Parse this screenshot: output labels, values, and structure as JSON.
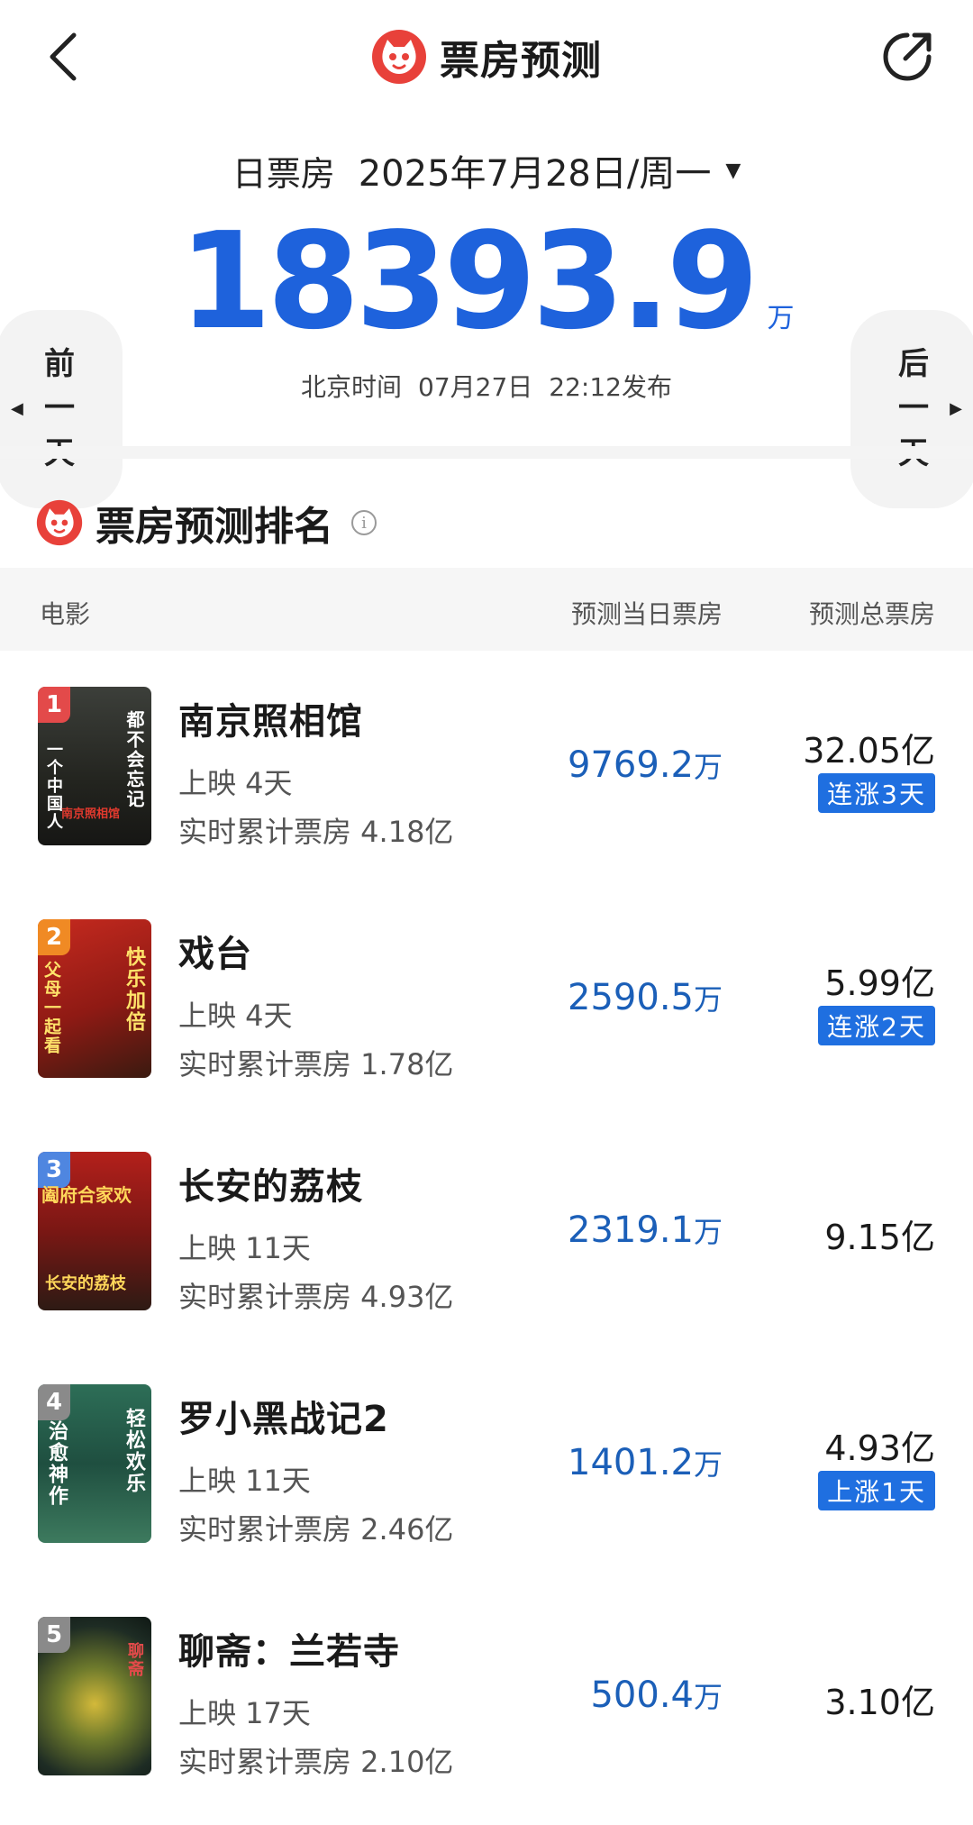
{
  "nav": {
    "title": "票房预测",
    "back_icon": "chevron-left-icon",
    "share_icon": "share-icon",
    "logo_color": "#e8413a"
  },
  "hero": {
    "date_label": "日票房",
    "date_value": "2025年7月28日/周一",
    "total_value": "18393.9",
    "total_unit": "万",
    "publish_zone": "北京时间",
    "publish_date": "07月27日",
    "publish_time": "22:12发布",
    "prev_label": [
      "前",
      "一",
      "天"
    ],
    "next_label": [
      "后",
      "一",
      "天"
    ],
    "accent_color": "#1e62dc"
  },
  "ranking": {
    "title": "票房预测排名",
    "columns": {
      "movie": "电影",
      "day": "预测当日票房",
      "total": "预测总票房"
    },
    "movies": [
      {
        "rank": "1",
        "title": "南京照相馆",
        "days": "上映 4天",
        "cumulative": "实时累计票房 4.18亿",
        "day_value": "9769.2",
        "day_unit": "万",
        "total": "32.05亿",
        "badge": "连涨3天",
        "rank_color": "#e34a4a",
        "poster_texts": [
          "都不会忘记",
          "一个中国人",
          "南京照相馆"
        ]
      },
      {
        "rank": "2",
        "title": "戏台",
        "days": "上映 4天",
        "cumulative": "实时累计票房 1.78亿",
        "day_value": "2590.5",
        "day_unit": "万",
        "total": "5.99亿",
        "badge": "连涨2天",
        "rank_color": "#f08a24",
        "poster_texts": [
          "快乐加倍",
          "父母一起看"
        ]
      },
      {
        "rank": "3",
        "title": "长安的荔枝",
        "days": "上映 11天",
        "cumulative": "实时累计票房 4.93亿",
        "day_value": "2319.1",
        "day_unit": "万",
        "total": "9.15亿",
        "badge": "",
        "rank_color": "#4f86e0",
        "poster_texts": [
          "阖府合家欢",
          "长安的荔枝"
        ]
      },
      {
        "rank": "4",
        "title": "罗小黑战记2",
        "days": "上映 11天",
        "cumulative": "实时累计票房 2.46亿",
        "day_value": "1401.2",
        "day_unit": "万",
        "total": "4.93亿",
        "badge": "上涨1天",
        "rank_color": "#8a8a8a",
        "poster_texts": [
          "轻松欢乐",
          "治愈神作"
        ]
      },
      {
        "rank": "5",
        "title": "聊斋：兰若寺",
        "days": "上映 17天",
        "cumulative": "实时累计票房 2.10亿",
        "day_value": "500.4",
        "day_unit": "万",
        "total": "3.10亿",
        "badge": "",
        "rank_color": "#8a8a8a",
        "poster_texts": [
          "聊斋"
        ]
      }
    ]
  }
}
